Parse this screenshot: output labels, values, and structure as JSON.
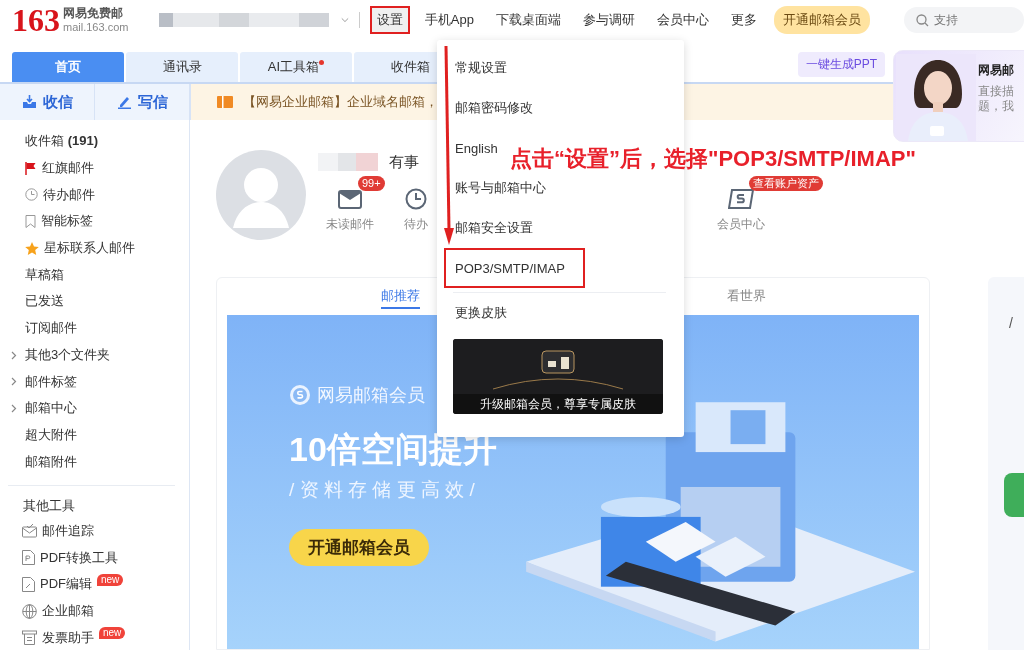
{
  "top_bar": {
    "logo_number": "163",
    "logo_title": "网易免费邮",
    "logo_domain": "mail.163.com",
    "nav": [
      {
        "label": "设置",
        "annotated": true
      },
      {
        "label": "手机App",
        "annotated": false
      },
      {
        "label": "下载桌面端",
        "annotated": false
      },
      {
        "label": "参与调研",
        "annotated": false
      },
      {
        "label": "会员中心",
        "annotated": false
      },
      {
        "label": "更多",
        "annotated": false
      }
    ],
    "vip_button": "开通邮箱会员",
    "search": {
      "placeholder": "支持"
    }
  },
  "tabs": [
    {
      "label": "首页",
      "selected": true,
      "dot": false
    },
    {
      "label": "通讯录",
      "selected": false,
      "dot": false
    },
    {
      "label": "AI工具箱",
      "selected": false,
      "dot": true
    },
    {
      "label": "收件箱",
      "selected": false,
      "dot": false
    }
  ],
  "ppt_button": "一键生成PPT",
  "assistant": {
    "title": "网易邮",
    "lines": [
      "直接描",
      "题，我"
    ]
  },
  "sidebar": {
    "receive": "收信",
    "compose": "写信",
    "folders": [
      {
        "label": "收件箱 **(191)**",
        "kind": "plain",
        "expandable": false
      },
      {
        "label": "红旗邮件",
        "kind": "flag",
        "expandable": false
      },
      {
        "label": "待办邮件",
        "kind": "clock",
        "expandable": false
      },
      {
        "label": "智能标签",
        "kind": "bookmark",
        "expandable": false
      },
      {
        "label": "星标联系人邮件",
        "kind": "star",
        "expandable": false
      },
      {
        "label": "草稿箱",
        "kind": "plain",
        "expandable": false
      },
      {
        "label": "已发送",
        "kind": "plain",
        "expandable": false
      },
      {
        "label": "订阅邮件",
        "kind": "plain",
        "expandable": false
      },
      {
        "label": "其他3个文件夹",
        "kind": "plain",
        "expandable": true
      },
      {
        "label": "邮件标签",
        "kind": "plain",
        "expandable": true
      },
      {
        "label": "邮箱中心",
        "kind": "plain",
        "expandable": true
      },
      {
        "label": "超大附件",
        "kind": "plain",
        "expandable": false
      },
      {
        "label": "邮箱附件",
        "kind": "plain",
        "expandable": false
      }
    ],
    "tools_title": "其他工具",
    "tools": [
      {
        "label": "邮件追踪",
        "kind": "track"
      },
      {
        "label": "PDF转换工具",
        "kind": "pdf"
      },
      {
        "label": "PDF编辑",
        "kind": "pdf-edit",
        "badge": "new"
      },
      {
        "label": "企业邮箱",
        "kind": "globe"
      },
      {
        "label": "发票助手",
        "kind": "invoice",
        "badge": "new"
      }
    ]
  },
  "notice": "【网易企业邮箱】企业域名邮箱，",
  "profile": {
    "greeting": "有事",
    "stats": [
      {
        "label": "未读邮件",
        "kind": "mail",
        "badge": "99+"
      },
      {
        "label": "待办",
        "kind": "clock"
      },
      {
        "label": "会员中心",
        "kind": "member",
        "badge": "查看账户资产"
      }
    ]
  },
  "feed": {
    "tabs": [
      {
        "label": "邮推荐",
        "selected": true
      },
      {
        "label": "看世界",
        "selected": false
      }
    ],
    "banner": {
      "brand": "网易邮箱会员",
      "headline": "10倍空间提升",
      "subline": "/ 资 料 存 储 更 高 效 /",
      "button": "开通邮箱会员"
    }
  },
  "side_panel": {
    "text": "/"
  },
  "settings_menu": {
    "items": [
      {
        "label": "常规设置",
        "annotated": false
      },
      {
        "label": "邮箱密码修改",
        "annotated": false
      },
      {
        "label": "English",
        "annotated": false
      },
      {
        "label": "账号与邮箱中心",
        "annotated": false
      },
      {
        "label": "邮箱安全设置",
        "annotated": false
      },
      {
        "label": "POP3/SMTP/IMAP",
        "annotated": true
      }
    ],
    "skin_label": "更换皮肤",
    "skin_caption": "升级邮箱会员，尊享专属皮肤"
  },
  "annotation": {
    "text": "点击“设置”后，选择\"POP3/SMTP/IMAP\""
  }
}
